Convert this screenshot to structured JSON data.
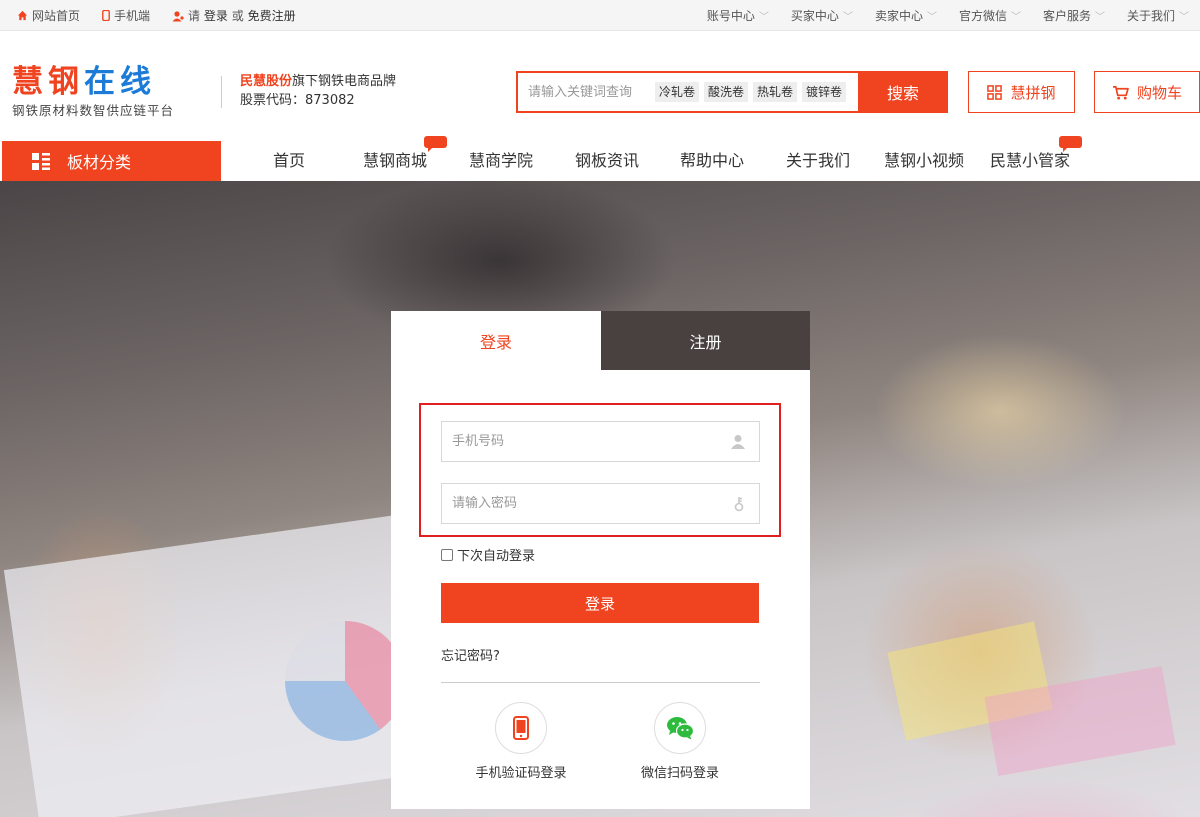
{
  "topbar": {
    "left": [
      {
        "icon": "home-icon",
        "label": "网站首页"
      },
      {
        "icon": "mobile-icon",
        "label": "手机端"
      }
    ],
    "login_prefix": "请",
    "login_link": "登录",
    "login_or": "或",
    "register_link": "免费注册",
    "right": [
      "账号中心",
      "买家中心",
      "卖家中心",
      "官方微信",
      "客户服务",
      "关于我们"
    ]
  },
  "header": {
    "logo_part1": "慧钢",
    "logo_part2": "在线",
    "logo_subtitle": "钢铁原材料数智供应链平台",
    "brand_highlight": "民慧股份",
    "brand_suffix": "旗下钢铁电商品牌",
    "stock_code": "股票代码：873082",
    "search_placeholder": "请输入关键词查询",
    "search_tags": [
      "冷轧卷",
      "酸洗卷",
      "热轧卷",
      "镀锌卷"
    ],
    "search_button": "搜索",
    "pin_button": "慧拼钢",
    "cart_button": "购物车"
  },
  "nav": {
    "category_button": "板材分类",
    "items": [
      "首页",
      "慧钢商城",
      "慧商学院",
      "钢板资讯",
      "帮助中心",
      "关于我们",
      "慧钢小视频",
      "民慧小管家"
    ]
  },
  "login": {
    "tab_login": "登录",
    "tab_register": "注册",
    "phone_placeholder": "手机号码",
    "password_placeholder": "请输入密码",
    "remember_label": "下次自动登录",
    "submit_button": "登录",
    "forgot_link": "忘记密码?",
    "sms_login": "手机验证码登录",
    "wechat_login": "微信扫码登录"
  },
  "colors": {
    "accent": "#f0431f",
    "logo_blue": "#1d7bd8",
    "highlight_box": "#e02020",
    "wechat_green": "#2dbb3e"
  }
}
